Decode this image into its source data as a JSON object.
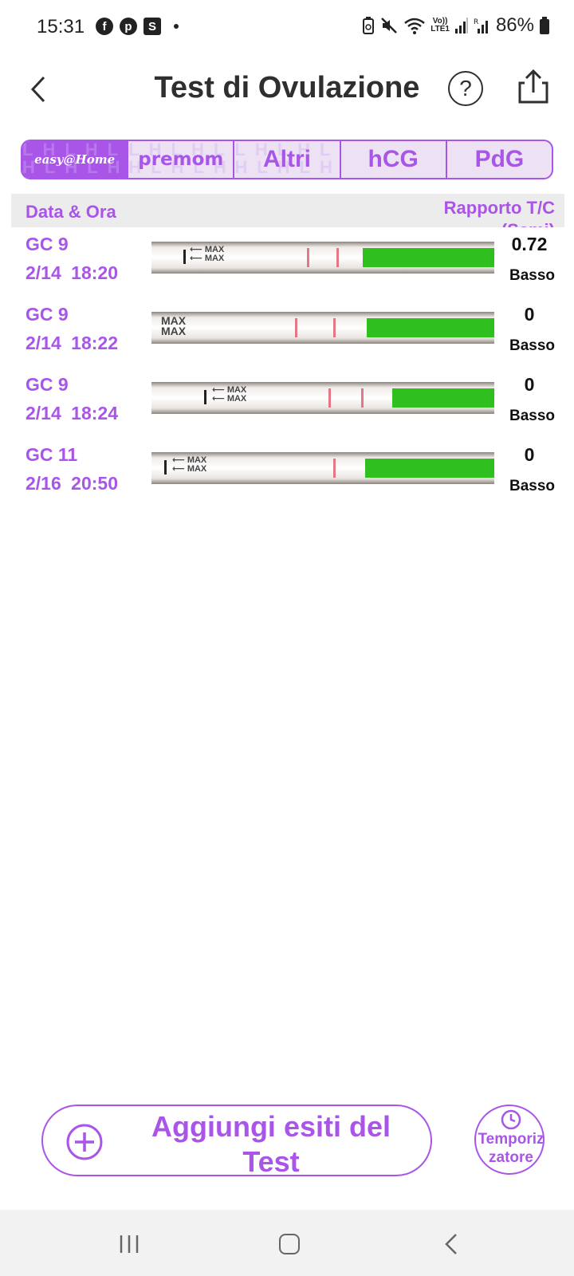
{
  "status_bar": {
    "time": "15:31",
    "notification_icons": [
      "facebook-icon",
      "pinterest-icon",
      "s-app-icon"
    ],
    "s_app_letter": "S",
    "facebook_letter": "f",
    "pinterest_letter": "p",
    "lte_top": "Vo))",
    "lte_bottom": "LTE1",
    "battery_percent": "86%"
  },
  "header": {
    "title": "Test di Ovulazione"
  },
  "tabs": [
    {
      "label": "easy@Home",
      "active": true
    },
    {
      "label": "premom",
      "active": false
    },
    {
      "label": "Altri",
      "active": false
    },
    {
      "label": "hCG",
      "active": false
    },
    {
      "label": "PdG",
      "active": false
    }
  ],
  "table": {
    "col_date": "Data & Ora",
    "col_ratio_line1": "Rapporto T/C",
    "col_ratio_line2": "(Semi)",
    "rows": [
      {
        "cycle": "GC 9",
        "datetime": "2/14 18:20",
        "value": "0.72",
        "level": "Basso",
        "max_text": "MAX"
      },
      {
        "cycle": "GC 9",
        "datetime": "2/14 18:22",
        "value": "0",
        "level": "Basso",
        "max_text": "MAX"
      },
      {
        "cycle": "GC 9",
        "datetime": "2/14 18:24",
        "value": "0",
        "level": "Basso",
        "max_text": "MAX"
      },
      {
        "cycle": "GC 11",
        "datetime": "2/16 20:50",
        "value": "0",
        "level": "Basso",
        "max_text": "MAX"
      }
    ]
  },
  "actions": {
    "add_label": "Aggiungi esiti del Test",
    "timer_label": "Temporizzatore"
  },
  "colors": {
    "accent": "#a855e8",
    "strip_green": "#2fbf1e",
    "test_line": "#e0566c"
  }
}
